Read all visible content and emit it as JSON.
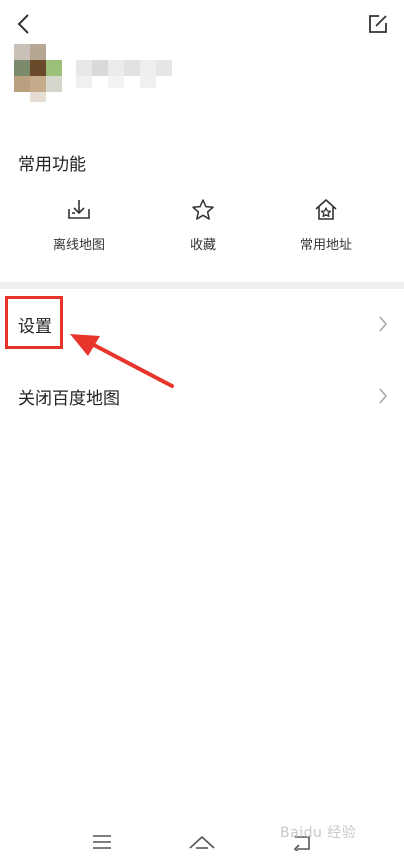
{
  "header": {
    "back_icon": "chevron-left-icon",
    "edit_icon": "edit-icon"
  },
  "profile": {
    "avatar_colors": [
      "#7a8a6a",
      "#6b4a2c",
      "#9bc07a",
      "#b7a792",
      "#d9cfc4"
    ],
    "name_pixels": [
      "#e0e0e0",
      "#ececec",
      "#d8d8d8",
      "#efefef",
      "#e6e6e6"
    ]
  },
  "common_functions": {
    "title": "常用功能",
    "items": [
      {
        "label": "离线地图",
        "icon": "offline-download-icon"
      },
      {
        "label": "收藏",
        "icon": "star-icon"
      },
      {
        "label": "常用地址",
        "icon": "home-star-icon"
      }
    ]
  },
  "menu": {
    "settings_label": "设置",
    "close_label": "关闭百度地图"
  },
  "colors": {
    "highlight": "#e8352b",
    "divider": "#efefef"
  },
  "bottom_nav": {
    "items": [
      "menu-icon",
      "home-icon",
      "back-icon"
    ]
  },
  "watermark": "Baidu 经验"
}
